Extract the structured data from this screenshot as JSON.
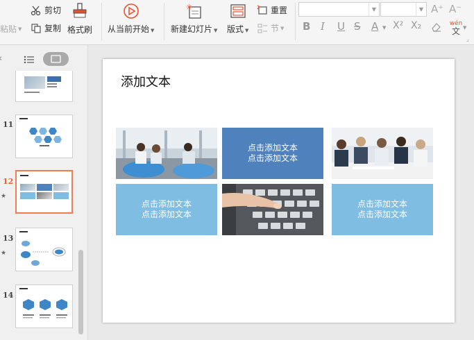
{
  "toolbar": {
    "paste_label": "粘贴",
    "cut_label": "剪切",
    "copy_label": "复制",
    "format_painter_label": "格式刷",
    "from_current_label": "从当前开始",
    "new_slide_label": "新建幻灯片",
    "layout_label": "版式",
    "reset_label": "重置",
    "section_label": "节",
    "font_name_value": "",
    "font_size_value": "",
    "increase_font_glyph": "A⁺",
    "decrease_font_glyph": "A⁻",
    "bold_glyph": "B",
    "italic_glyph": "I",
    "underline_glyph": "U",
    "strike_glyph": "S",
    "font_color_glyph": "A",
    "superscript_glyph": "X²",
    "subscript_glyph": "X₂",
    "phonetic_top": "wén",
    "phonetic_bottom": "文"
  },
  "panel": {
    "slides": [
      {
        "number": "11"
      },
      {
        "number": "12",
        "selected": true
      },
      {
        "number": "13"
      },
      {
        "number": "14"
      }
    ]
  },
  "slide": {
    "title": "添加文本",
    "tiles": [
      {
        "line1": "点击添加文本",
        "line2": "点击添加文本"
      },
      {
        "line1": "点击添加文本",
        "line2": "点击添加文本"
      },
      {
        "line1": "点击添加文本",
        "line2": "点击添加文本"
      }
    ]
  },
  "colors": {
    "accent_dark_blue": "#4f81bd",
    "accent_light_blue": "#7fbde3",
    "selected_border": "#f07b55",
    "selected_number": "#e8642d"
  }
}
